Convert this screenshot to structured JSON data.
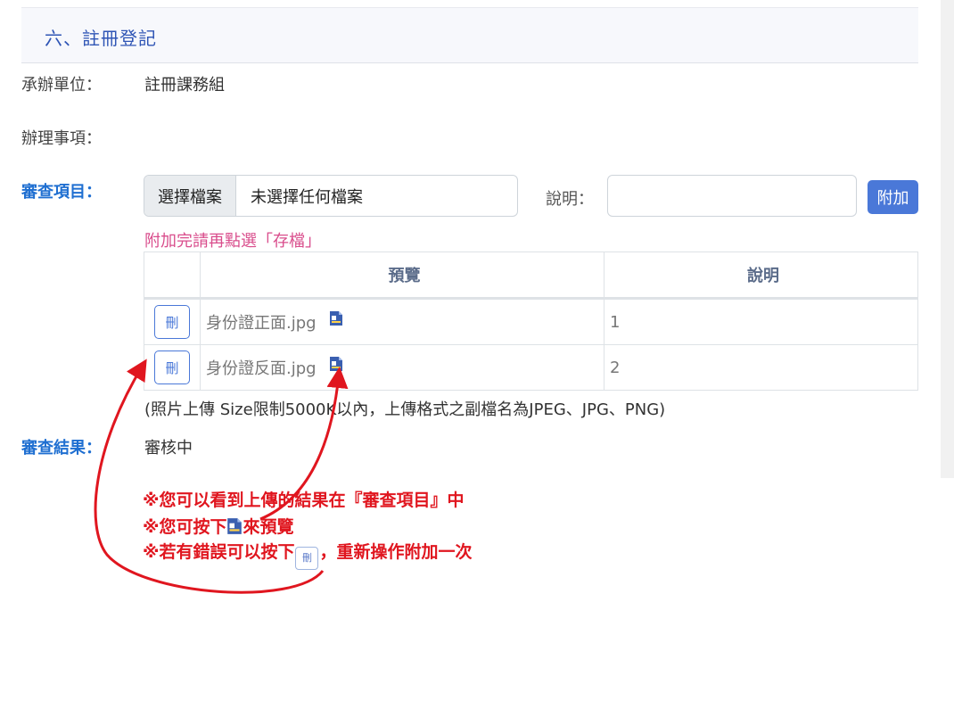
{
  "section": {
    "title": "六、註冊登記"
  },
  "fields": {
    "unit_label": "承辦單位：",
    "unit_value": "註冊課務組",
    "matter_label": "辦理事項：",
    "review_items_label": "審查項目：",
    "review_result_label": "審查結果：",
    "review_result_value": "審核中"
  },
  "upload": {
    "choose_file_label": "選擇檔案",
    "no_file_text": "未選擇任何檔案",
    "desc_label": "說明：",
    "desc_value": "",
    "attach_button": "附加",
    "hint": "附加完請再點選「存檔」"
  },
  "table": {
    "headers": [
      "",
      "預覽",
      "說明"
    ],
    "rows": [
      {
        "delete_label": "刪",
        "filename": "身份證正面.jpg",
        "description": "1"
      },
      {
        "delete_label": "刪",
        "filename": "身份證反面.jpg",
        "description": "2"
      }
    ]
  },
  "note": "(照片上傳 Size限制5000K以內，上傳格式之副檔名為JPEG、JPG、PNG)",
  "annotations": {
    "line1": "※您可以看到上傳的結果在『審查項目』中",
    "line2_prefix": "※您可按下",
    "line2_suffix": "來預覽",
    "line3_prefix": "※若有錯誤可以按下",
    "line3_suffix": "，重新操作附加一次",
    "inline_delete": "刪"
  },
  "colors": {
    "section_title": "#2f55b5",
    "label_blue": "#1f6fd1",
    "button_blue": "#4a78d8",
    "hint_pink": "#d94d8c",
    "annotation_red": "#e0161f"
  },
  "icons": [
    "file-preview-icon",
    "delete-button"
  ]
}
